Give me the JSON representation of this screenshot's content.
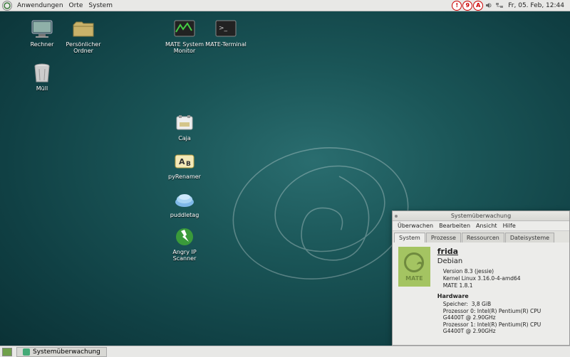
{
  "topPanel": {
    "menus": {
      "apps": "Anwendungen",
      "places": "Orte",
      "system": "System"
    },
    "trayLetters": {
      "a": "!",
      "b": "9",
      "c": "A"
    },
    "clock": "Fr, 05. Feb, 12:44"
  },
  "bottomPanel": {
    "task": "Systemüberwachung"
  },
  "desktop": {
    "computer": "Rechner",
    "home": "Persönlicher Ordner",
    "trash": "Müll",
    "sysmon": "MATE System Monitor",
    "terminal": "MATE-Terminal",
    "caja": "Caja",
    "pyrenamer": "pyRenamer",
    "puddletag": "puddletag",
    "angryip": "Angry IP Scanner"
  },
  "window": {
    "title": "Systemüberwachung",
    "menus": {
      "monitor": "Überwachen",
      "edit": "Bearbeiten",
      "view": "Ansicht",
      "help": "Hilfe"
    },
    "tabs": {
      "system": "System",
      "processes": "Prozesse",
      "resources": "Ressourcen",
      "filesystems": "Dateisysteme"
    },
    "info": {
      "hostname": "frida",
      "os": "Debian",
      "version": "Version 8.3 (jessie)",
      "kernel": "Kernel Linux 3.16.0-4-amd64",
      "mate": "MATE 1.8.1",
      "hwHeader": "Hardware",
      "memLabel": "Speicher:",
      "memValue": "3,8 GiB",
      "cpu0": "Prozessor 0: Intel(R) Pentium(R) CPU G4400T @ 2.90GHz",
      "cpu1": "Prozessor 1: Intel(R) Pentium(R) CPU G4400T @ 2.90GHz"
    },
    "mateLabel": "MATE"
  }
}
